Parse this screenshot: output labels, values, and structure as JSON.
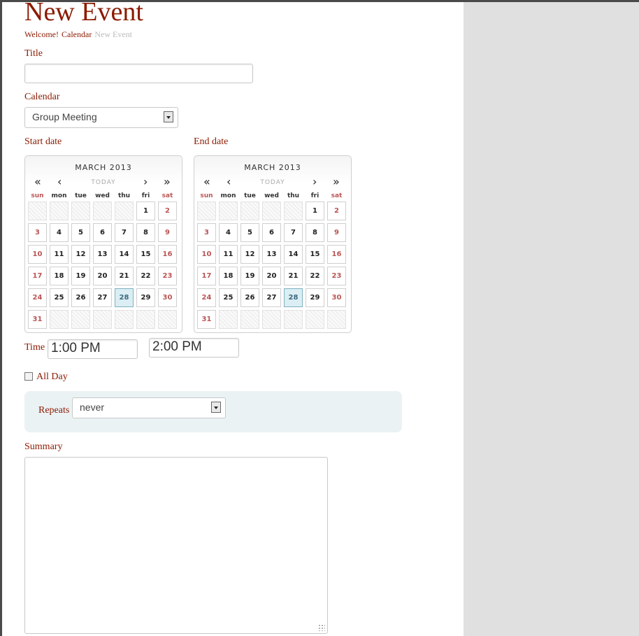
{
  "page": {
    "title": "New Event"
  },
  "breadcrumb": {
    "items": [
      "Welcome!",
      "Calendar"
    ],
    "current": "New Event"
  },
  "form": {
    "title_label": "Title",
    "title_value": "",
    "calendar_label": "Calendar",
    "calendar_value": "Group Meeting",
    "start_label": "Start date",
    "end_label": "End date",
    "time_label": "Time",
    "start_time": "1:00 PM",
    "end_time": "2:00 PM",
    "allday_label": "All Day",
    "allday_checked": false,
    "repeats_label": "Repeats",
    "repeats_value": "never",
    "summary_label": "Summary",
    "summary_value": ""
  },
  "calendars": [
    {
      "month": "MARCH 2013",
      "today": "TODAY",
      "selected_day": 28
    },
    {
      "month": "MARCH 2013",
      "today": "TODAY",
      "selected_day": 28
    }
  ],
  "calendar_nav": {
    "prev_year": "«",
    "prev_month": "‹",
    "next_month": "›",
    "next_year": "»"
  },
  "weekdays": [
    "sun",
    "mon",
    "tue",
    "wed",
    "thu",
    "fri",
    "sat"
  ],
  "month_layout": {
    "first_weekday": 5,
    "days": 31
  },
  "colors": {
    "accent": "#8b1a00",
    "weekend": "#b55555",
    "selected_bg": "#dbeef3",
    "repeats_bg": "#eaf2f4"
  }
}
